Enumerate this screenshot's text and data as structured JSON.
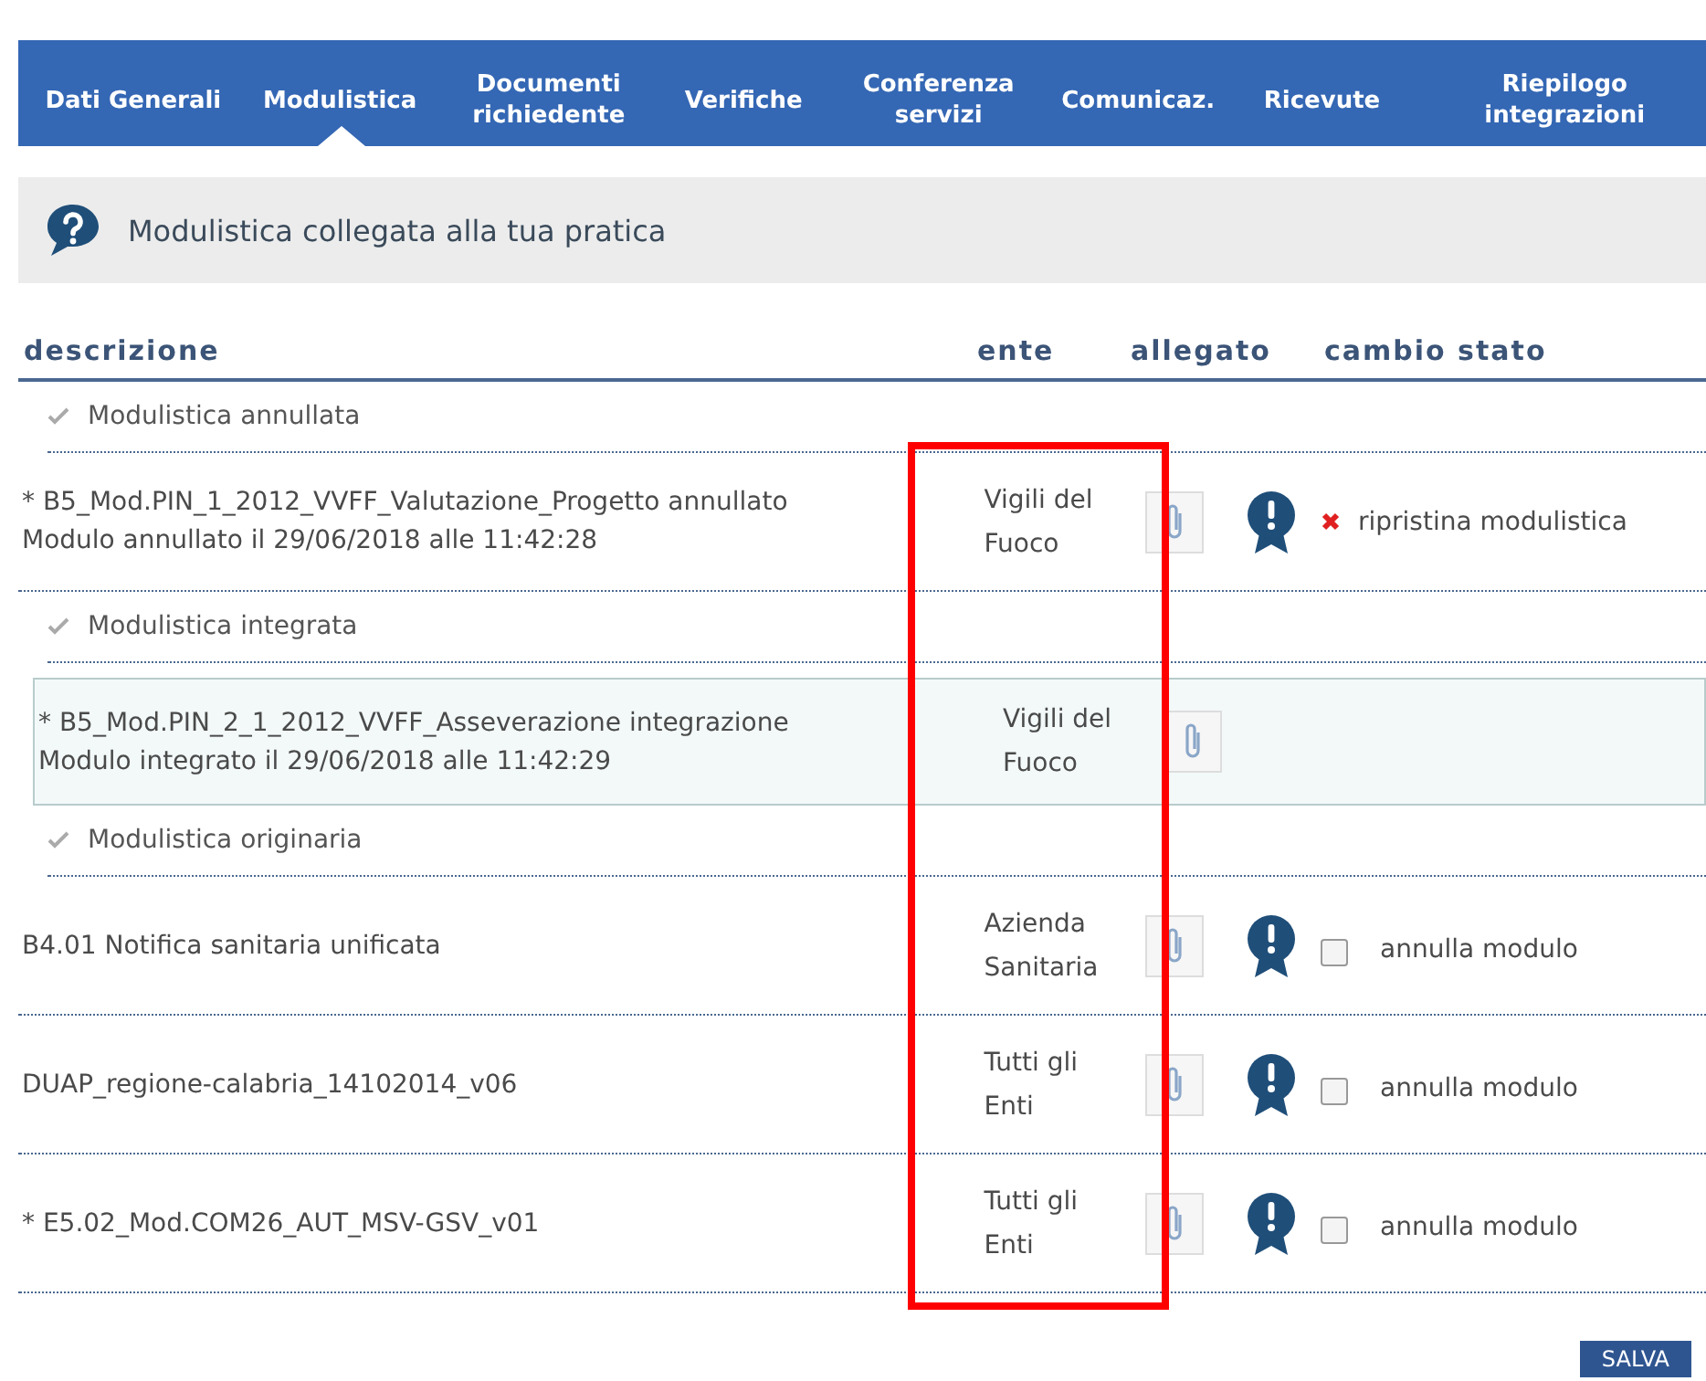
{
  "tabs": [
    {
      "label": "Dati Generali",
      "selected": false
    },
    {
      "label": "Modulistica",
      "selected": true
    },
    {
      "label": "Documenti richiedente",
      "selected": false
    },
    {
      "label": "Verifiche",
      "selected": false
    },
    {
      "label": "Conferenza servizi",
      "selected": false
    },
    {
      "label": "Comunicaz.",
      "selected": false
    },
    {
      "label": "Ricevute",
      "selected": false
    },
    {
      "label": "Riepilogo integrazioni",
      "selected": false
    }
  ],
  "info": {
    "text": "Modulistica collegata alla tua pratica"
  },
  "table": {
    "columns": [
      "descrizione",
      "ente",
      "allegato",
      "cambio stato"
    ],
    "groups": [
      {
        "title": "Modulistica annullata",
        "rows": [
          {
            "description": [
              "* B5_Mod.PIN_1_2012_VVFF_Valutazione_Progetto annullato",
              "Modulo annullato il  29/06/2018 alle 11:42:28"
            ],
            "ente": "Vigili del Fuoco",
            "selected": false,
            "status_icon": true,
            "action": {
              "kind": "restore",
              "label": "ripristina modulistica"
            }
          }
        ]
      },
      {
        "title": "Modulistica integrata",
        "rows": [
          {
            "description": [
              "* B5_Mod.PIN_2_1_2012_VVFF_Asseverazione integrazione",
              "Modulo integrato il  29/06/2018 alle 11:42:29"
            ],
            "ente": "Vigili del Fuoco",
            "selected": true,
            "status_icon": false
          }
        ]
      },
      {
        "title": "Modulistica originaria",
        "rows": [
          {
            "description": [
              "B4.01 Notifica sanitaria unificata"
            ],
            "ente": "Azienda Sanitaria",
            "selected": false,
            "status_icon": true,
            "action": {
              "kind": "checkbox",
              "label": "annulla modulo",
              "checked": false
            }
          },
          {
            "description": [
              "DUAP_regione-calabria_14102014_v06"
            ],
            "ente": "Tutti gli Enti",
            "selected": false,
            "status_icon": true,
            "action": {
              "kind": "checkbox",
              "label": "annulla modulo",
              "checked": false
            }
          },
          {
            "description": [
              "* E5.02_Mod.COM26_AUT_MSV-GSV_v01"
            ],
            "ente": "Tutti gli Enti",
            "selected": false,
            "status_icon": true,
            "action": {
              "kind": "checkbox",
              "label": "annulla modulo",
              "checked": false
            }
          }
        ]
      }
    ]
  },
  "save_button": {
    "label": "SALVA"
  },
  "annotation": {
    "kind": "rectangle"
  }
}
